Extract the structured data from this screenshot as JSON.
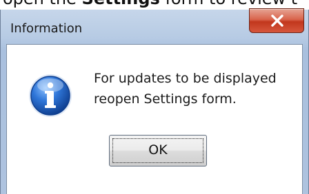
{
  "background_doc": {
    "prefix": "open the ",
    "bold": "Settings",
    "suffix": " form to review t"
  },
  "dialog": {
    "title": "Information",
    "close_icon": "close-icon",
    "icon": "information-icon",
    "message_lines": [
      "For updates to be displayed",
      "reopen Settings form."
    ],
    "ok_label": "OK"
  },
  "colors": {
    "close_button": "#c8452c",
    "info_icon": "#1f5fc0",
    "title_bar": "#b7cbe4"
  }
}
